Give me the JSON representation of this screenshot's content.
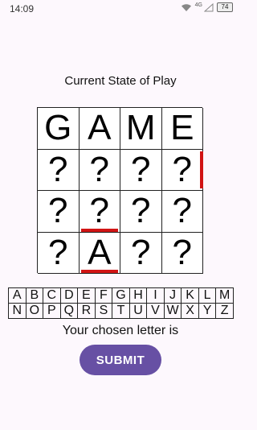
{
  "status_bar": {
    "time": "14:09",
    "network_label": "4G",
    "battery": "74"
  },
  "title": "Current State of Play",
  "grid": [
    [
      {
        "ch": "G"
      },
      {
        "ch": "A"
      },
      {
        "ch": "M"
      },
      {
        "ch": "E"
      }
    ],
    [
      {
        "ch": "?"
      },
      {
        "ch": "?"
      },
      {
        "ch": "?"
      },
      {
        "ch": "?",
        "right_bar": true
      }
    ],
    [
      {
        "ch": "?"
      },
      {
        "ch": "?",
        "bottom_bar": true
      },
      {
        "ch": "?"
      },
      {
        "ch": "?"
      }
    ],
    [
      {
        "ch": "?"
      },
      {
        "ch": "A",
        "bottom_bar": true
      },
      {
        "ch": "?"
      },
      {
        "ch": "?"
      }
    ]
  ],
  "keyboard": {
    "rows": [
      [
        "A",
        "B",
        "C",
        "D",
        "E",
        "F",
        "G",
        "H",
        "I",
        "J",
        "K",
        "L",
        "M"
      ],
      [
        "N",
        "O",
        "P",
        "Q",
        "R",
        "S",
        "T",
        "U",
        "V",
        "W",
        "X",
        "Y",
        "Z"
      ]
    ]
  },
  "chosen_text": "Your chosen letter is",
  "submit_label": "SUBMIT",
  "colors": {
    "accent": "#6750a4",
    "highlight": "#d11414"
  }
}
